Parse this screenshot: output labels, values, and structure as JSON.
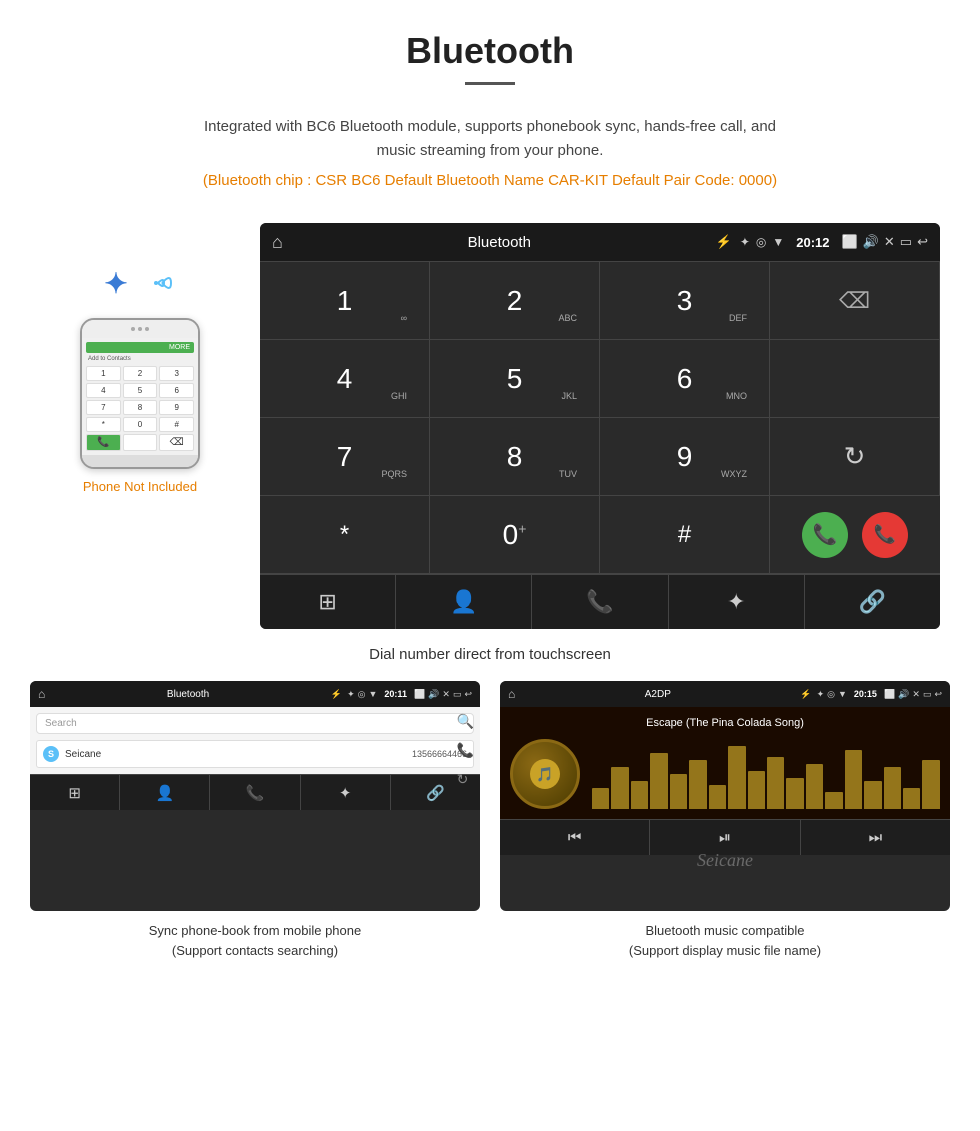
{
  "page": {
    "title": "Bluetooth",
    "divider": true,
    "intro_line1": "Integrated with BC6 Bluetooth module, supports phonebook sync, hands-free call, and",
    "intro_line2": "music streaming from your phone.",
    "specs": "(Bluetooth chip : CSR BC6   Default Bluetooth Name CAR-KIT    Default Pair Code: 0000)"
  },
  "phone_illustration": {
    "not_included_label": "Phone Not Included",
    "green_bar_text": "MORE",
    "add_contact_text": "Add to Contacts",
    "keys": [
      "1",
      "2",
      "3",
      "4",
      "5",
      "6",
      "7",
      "8",
      "9",
      "*",
      "0",
      "#"
    ]
  },
  "dial_screen": {
    "status_bar": {
      "title": "Bluetooth",
      "usb_icon": "⚡",
      "time": "20:12"
    },
    "keys": [
      {
        "num": "1",
        "letters": "∞"
      },
      {
        "num": "2",
        "letters": "ABC"
      },
      {
        "num": "3",
        "letters": "DEF"
      },
      {
        "num": "",
        "letters": ""
      },
      {
        "num": "4",
        "letters": "GHI"
      },
      {
        "num": "5",
        "letters": "JKL"
      },
      {
        "num": "6",
        "letters": "MNO"
      },
      {
        "num": "",
        "letters": ""
      },
      {
        "num": "7",
        "letters": "PQRS"
      },
      {
        "num": "8",
        "letters": "TUV"
      },
      {
        "num": "9",
        "letters": "WXYZ"
      },
      {
        "num": "",
        "letters": ""
      },
      {
        "num": "*",
        "letters": ""
      },
      {
        "num": "0+",
        "letters": ""
      },
      {
        "num": "#",
        "letters": ""
      },
      {
        "num": "",
        "letters": ""
      }
    ],
    "bottom_nav_items": [
      "grid",
      "person",
      "phone",
      "bluetooth",
      "link"
    ]
  },
  "dial_caption": "Dial number direct from touchscreen",
  "phonebook_screen": {
    "status_bar": {
      "title": "Bluetooth",
      "time": "20:11"
    },
    "search_placeholder": "Search",
    "contacts": [
      {
        "letter": "S",
        "name": "Seicane",
        "number": "13566664466"
      }
    ],
    "bottom_nav_items": [
      "grid",
      "person",
      "phone",
      "bluetooth",
      "link"
    ]
  },
  "phonebook_caption_line1": "Sync phone-book from mobile phone",
  "phonebook_caption_line2": "(Support contacts searching)",
  "music_screen": {
    "status_bar": {
      "title": "A2DP",
      "time": "20:15"
    },
    "song_title": "Escape (The Pina Colada Song)",
    "bottom_nav_items": [
      "skip-back",
      "play-pause",
      "skip-forward"
    ]
  },
  "music_caption_line1": "Bluetooth music compatible",
  "music_caption_line2": "(Support display music file name)",
  "watermark": "Seicane"
}
